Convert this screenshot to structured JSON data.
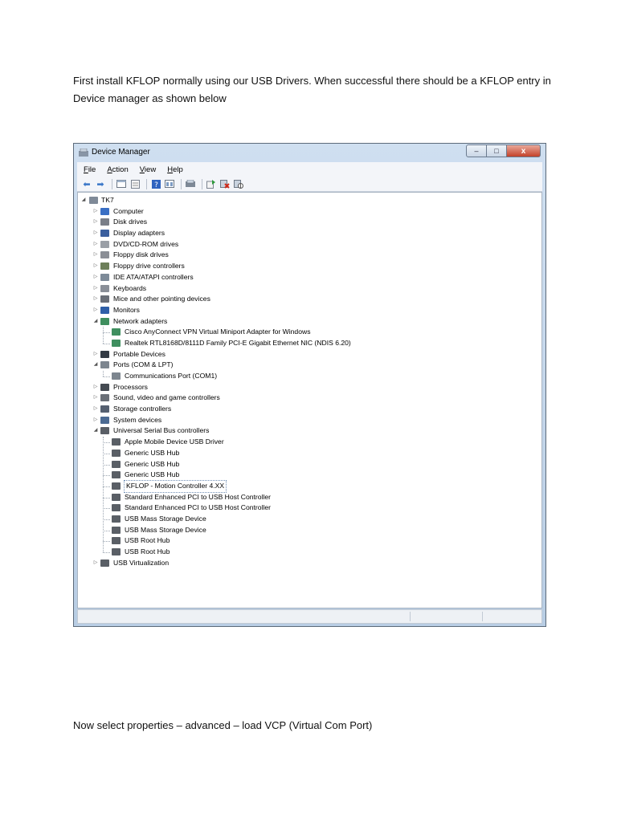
{
  "document": {
    "intro_line1": "First install KFLOP normally using our USB Drivers.  When successful there should be a KFLOP entry in",
    "intro_line2": "Device manager as shown below",
    "outro": "Now select properties – advanced – load VCP (Virtual Com Port)"
  },
  "window": {
    "title": "Device Manager",
    "buttons": {
      "minimize": "–",
      "maximize": "□",
      "close": "x"
    },
    "menu": [
      {
        "key": "F",
        "rest": "ile"
      },
      {
        "key": "A",
        "rest": "ction"
      },
      {
        "key": "V",
        "rest": "iew"
      },
      {
        "key": "H",
        "rest": "elp"
      }
    ]
  },
  "tree": {
    "root": "TK7",
    "categories": [
      {
        "label": "Computer",
        "expanded": false,
        "icon": "computer-icon",
        "color": "#3a6fc4"
      },
      {
        "label": "Disk drives",
        "expanded": false,
        "icon": "disk-drive-icon",
        "color": "#7a7f88"
      },
      {
        "label": "Display adapters",
        "expanded": false,
        "icon": "display-adapter-icon",
        "color": "#3b5f9e"
      },
      {
        "label": "DVD/CD-ROM drives",
        "expanded": false,
        "icon": "dvd-drive-icon",
        "color": "#9a9fa6"
      },
      {
        "label": "Floppy disk drives",
        "expanded": false,
        "icon": "floppy-disk-icon",
        "color": "#8b8f96"
      },
      {
        "label": "Floppy drive controllers",
        "expanded": false,
        "icon": "floppy-controller-icon",
        "color": "#6d7f5a"
      },
      {
        "label": "IDE ATA/ATAPI controllers",
        "expanded": false,
        "icon": "ide-controller-icon",
        "color": "#7d8a98"
      },
      {
        "label": "Keyboards",
        "expanded": false,
        "icon": "keyboard-icon",
        "color": "#8a8f98"
      },
      {
        "label": "Mice and other pointing devices",
        "expanded": false,
        "icon": "mouse-icon",
        "color": "#6a6f78"
      },
      {
        "label": "Monitors",
        "expanded": false,
        "icon": "monitor-icon",
        "color": "#2f5fa8"
      },
      {
        "label": "Network adapters",
        "expanded": true,
        "icon": "network-adapter-icon",
        "color": "#3f8f5f",
        "children": [
          {
            "label": "Cisco AnyConnect VPN Virtual Miniport Adapter for Windows",
            "selected": false
          },
          {
            "label": "Realtek RTL8168D/8111D Family PCI-E Gigabit Ethernet NIC (NDIS 6.20)",
            "selected": false
          }
        ]
      },
      {
        "label": "Portable Devices",
        "expanded": false,
        "icon": "portable-device-icon",
        "color": "#333a44"
      },
      {
        "label": "Ports (COM & LPT)",
        "expanded": true,
        "icon": "port-icon",
        "color": "#7d868f",
        "children": [
          {
            "label": "Communications Port (COM1)",
            "selected": false
          }
        ]
      },
      {
        "label": "Processors",
        "expanded": false,
        "icon": "processor-icon",
        "color": "#444a52"
      },
      {
        "label": "Sound, video and game controllers",
        "expanded": false,
        "icon": "sound-icon",
        "color": "#6b7078"
      },
      {
        "label": "Storage controllers",
        "expanded": false,
        "icon": "storage-controller-icon",
        "color": "#556070"
      },
      {
        "label": "System devices",
        "expanded": false,
        "icon": "system-device-icon",
        "color": "#4c6b93"
      },
      {
        "label": "Universal Serial Bus controllers",
        "expanded": true,
        "icon": "usb-icon",
        "color": "#5a5f66",
        "children": [
          {
            "label": "Apple Mobile Device USB Driver",
            "selected": false
          },
          {
            "label": "Generic USB Hub",
            "selected": false
          },
          {
            "label": "Generic USB Hub",
            "selected": false
          },
          {
            "label": "Generic USB Hub",
            "selected": false
          },
          {
            "label": "KFLOP - Motion Controller 4.XX",
            "selected": true
          },
          {
            "label": "Standard Enhanced PCI to USB Host Controller",
            "selected": false
          },
          {
            "label": "Standard Enhanced PCI to USB Host Controller",
            "selected": false
          },
          {
            "label": "USB Mass Storage Device",
            "selected": false
          },
          {
            "label": "USB Mass Storage Device",
            "selected": false
          },
          {
            "label": "USB Root Hub",
            "selected": false
          },
          {
            "label": "USB Root Hub",
            "selected": false
          }
        ]
      },
      {
        "label": "USB Virtualization",
        "expanded": false,
        "icon": "usb-virtualization-icon",
        "color": "#5a5f66"
      }
    ]
  }
}
